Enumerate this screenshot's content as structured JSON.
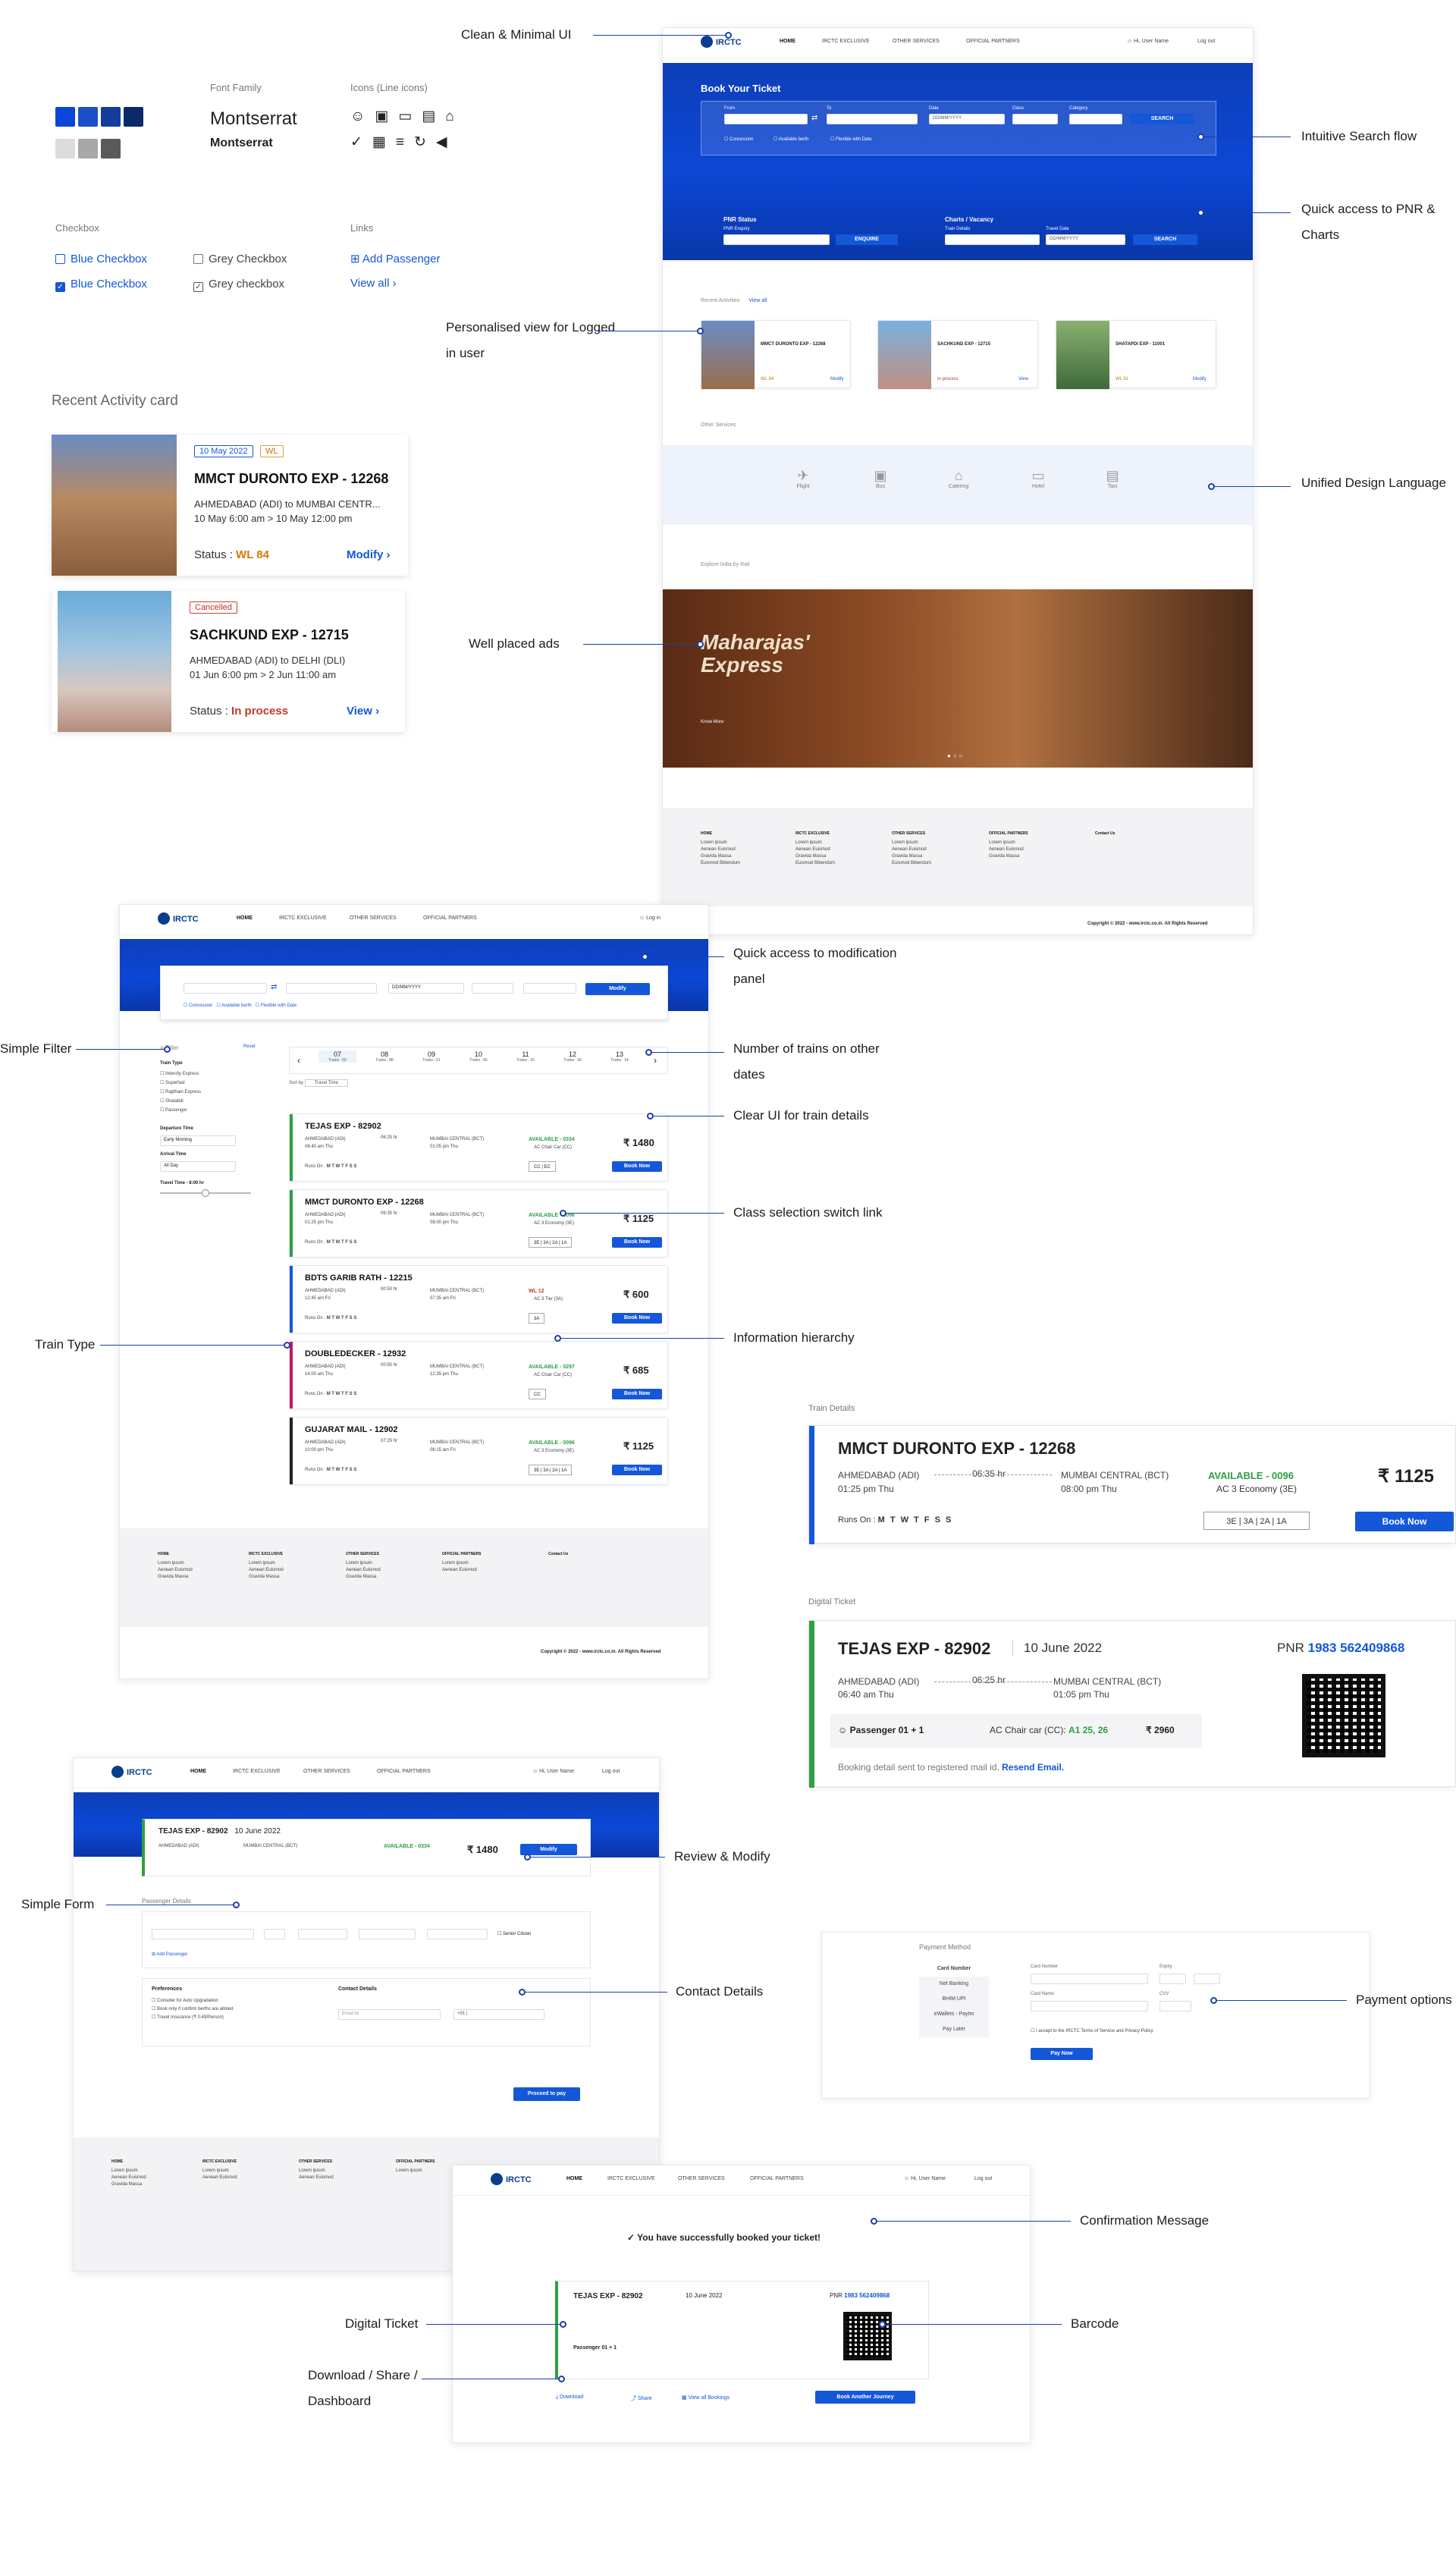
{
  "style_guide": {
    "font_family_label": "Font Family",
    "font_name": "Montserrat",
    "font_name_small": "Montserrat",
    "icons_label": "Icons (Line icons)",
    "colors": [
      "#0a46d8",
      "#1d4fc8",
      "#143c9a",
      "#0b2a6a",
      "#dcdcdc",
      "#a8a8a8",
      "#5a5a5a"
    ],
    "checkbox_label": "Checkbox",
    "blue_checkbox": "Blue Checkbox",
    "grey_checkbox": "Grey Checkbox",
    "blue_checkbox_checked": "Blue Checkbox",
    "grey_checkbox_checked": "Grey checkbox",
    "links_label": "Links",
    "add_passenger": "Add Passenger",
    "view_all": "View all",
    "recent_activity_label": "Recent Activity card"
  },
  "activity_cards": [
    {
      "date": "10 May 2022",
      "tag": "WL",
      "name": "MMCT DURONTO EXP - 12268",
      "route": "AHMEDABAD (ADI) to MUMBAI CENTR...",
      "time": "10 May 6:00 am > 10 May 12:00 pm",
      "status_label": "Status :",
      "status": "WL 84",
      "action": "Modify"
    },
    {
      "tag": "Cancelled",
      "name": "SACHKUND EXP - 12715",
      "route": "AHMEDABAD (ADI) to DELHI (DLI)",
      "time": "01 Jun 6:00 pm > 2 Jun 11:00 am",
      "status_label": "Status :",
      "status": "In process",
      "action": "View"
    }
  ],
  "annotations": {
    "clean_ui": "Clean & Minimal UI",
    "search_flow": "Intuitive Search flow",
    "pnr_charts": "Quick access to PNR & Charts",
    "personalised": "Personalised view for Logged in user",
    "unified": "Unified Design Language",
    "ads": "Well placed ads",
    "modify_panel": "Quick access to modification panel",
    "simple_filter": "Simple Filter",
    "num_trains": "Number of trains on other dates",
    "clear_ui": "Clear UI for train details",
    "class_switch": "Class selection switch link",
    "info_hierarchy": "Information hierarchy",
    "train_type": "Train Type",
    "review_modify": "Review & Modify",
    "simple_form": "Simple Form",
    "contact_details": "Contact Details",
    "payment_options": "Payment options",
    "confirmation": "Confirmation Message",
    "digital_ticket": "Digital Ticket",
    "barcode": "Barcode",
    "download_share": "Download / Share / Dashboard"
  },
  "home": {
    "logo": "IRCTC",
    "nav": [
      "HOME",
      "IRCTC EXCLUSIVE",
      "OTHER SERVICES",
      "OFFICIAL PARTNERS"
    ],
    "user": "Hi, User Name",
    "logout": "Log out",
    "book_title": "Book Your Ticket",
    "from": "From",
    "to": "To",
    "date": "Date",
    "class": "Class",
    "category": "Category",
    "date_val": "DD/MM/YYYY",
    "search": "SEARCH",
    "concession": "Concession",
    "berth": "Available berth",
    "flexible": "Flexible with Date",
    "pnr_title": "PNR Status",
    "pnr_enquiry": "PNR Enquiry",
    "enquire": "ENQUIRE",
    "charts_title": "Charts / Vacancy",
    "train_details": "Train Details",
    "travel_date": "Travel Date",
    "recent": "Recent Activities",
    "view_all": "View all",
    "other_services": "Other Services",
    "services": [
      "Flight",
      "Bus",
      "Catering",
      "Hotel",
      "Taxi"
    ],
    "explore": "Explore India by Rail",
    "ad_title": "Maharajas' Express",
    "ad_cta": "Know More",
    "recent_cards": [
      {
        "name": "MMCT DURONTO EXP - 12268",
        "status": "WL 84",
        "action": "Modify"
      },
      {
        "name": "SACHKUND EXP - 12715",
        "status": "In process",
        "action": "View"
      },
      {
        "name": "SHATAPDI EXP - 11001",
        "status": "WL 81",
        "action": "Modify"
      }
    ],
    "footer_heads": [
      "HOME",
      "IRCTC EXCLUSIVE",
      "OTHER SERVICES",
      "OFFICIAL PARTNERS",
      "Contact Us"
    ],
    "copyright": "Copyright © 2022 - www.irctc.co.in. All Rights Reserved"
  },
  "results": {
    "login": "Log in",
    "modify": "Modify",
    "filter": "Filter",
    "reset": "Reset",
    "train_type": "Train Type",
    "types": [
      "Intercity Express",
      "Superfast",
      "Rajdhani Express",
      "Shatabdi",
      "Passenger"
    ],
    "departure": "Departure Time",
    "early": "Early Morning",
    "arrival": "Arrival Time",
    "all_day": "All Day",
    "travel_time": "Travel Time - 8:00 hr",
    "dates": [
      {
        "d": "07",
        "t": "Trains : 50"
      },
      {
        "d": "08",
        "t": "Trains : 88"
      },
      {
        "d": "09",
        "t": "Trains : 61"
      },
      {
        "d": "10",
        "t": "Trains : 55"
      },
      {
        "d": "11",
        "t": "Trains : 15"
      },
      {
        "d": "12",
        "t": "Trains : 18"
      },
      {
        "d": "13",
        "t": "Trains : 14"
      }
    ],
    "sort": "Sort by",
    "sort_val": "Travel Time",
    "trains": [
      {
        "name": "TEJAS EXP - 82902",
        "color": "#2ea043",
        "from": "AHMEDABAD (ADI)",
        "dep": "06:40 am Thu",
        "dur": "06:25 hr",
        "to": "MUMBAI CENTRAL (BCT)",
        "arr": "01:05 pm Thu",
        "avail": "AVAILABLE - 0334",
        "avcol": "#2ea043",
        "cls": "AC Chair Car (CC)",
        "fare": "₹ 1480",
        "sel": "CC | EC"
      },
      {
        "name": "MMCT DURONTO EXP - 12268",
        "color": "#2ea043",
        "from": "AHMEDABAD (ADI)",
        "dep": "01:25 pm Thu",
        "dur": "06:35 hr",
        "to": "MUMBAI CENTRAL (BCT)",
        "arr": "08:00 pm Thu",
        "avail": "AVAILABLE - 0096",
        "avcol": "#2ea043",
        "cls": "AC 3 Economy (3E)",
        "fare": "₹ 1125",
        "sel": "3E | 3A | 2A | 1A"
      },
      {
        "name": "BDTS GARIB RATH - 12215",
        "color": "#1457d9",
        "from": "AHMEDABAD (ADI)",
        "dep": "12:45 am Fri",
        "dur": "00:50 hr",
        "to": "MUMBAI CENTRAL (BCT)",
        "arr": "07:35 am Fri",
        "avail": "WL 12",
        "avcol": "#c0392b",
        "cls": "AC 3 Tier (3A)",
        "fare": "₹ 600",
        "sel": "3A"
      },
      {
        "name": "DOUBLEDECKER - 12932",
        "color": "#c2185b",
        "from": "AHMEDABAD (ADI)",
        "dep": "14:00 am Thu",
        "dur": "00:50 hr",
        "to": "MUMBAI CENTRAL (BCT)",
        "arr": "12:35 pm Thu",
        "avail": "AVAILABLE - 0297",
        "avcol": "#2ea043",
        "cls": "AC Chair Car (CC)",
        "fare": "₹ 685",
        "sel": "CC"
      },
      {
        "name": "GUJARAT MAIL - 12902",
        "color": "#222",
        "from": "AHMEDABAD (ADI)",
        "dep": "10:00 pm Thu",
        "dur": "07:25 hr",
        "to": "MUMBAI CENTRAL (BCT)",
        "arr": "06:15 am Fri",
        "avail": "AVAILABLE - 0096",
        "avcol": "#2ea043",
        "cls": "AC 3 Economy (3E)",
        "fare": "₹ 1125",
        "sel": "3E | 3A | 2A | 1A"
      }
    ],
    "runs_on": "Runs On :",
    "days": "M T W T F S S",
    "book_now": "Book Now"
  },
  "train_details": {
    "label": "Train Details",
    "name": "MMCT DURONTO EXP - 12268",
    "from": "AHMEDABAD (ADI)",
    "dep": "01:25 pm Thu",
    "dur": "06:35 hr",
    "to": "MUMBAI CENTRAL (BCT)",
    "arr": "08:00 pm Thu",
    "avail": "AVAILABLE - 0096",
    "cls": "AC 3 Economy (3E)",
    "fare": "₹ 1125",
    "runs_on": "Runs On :",
    "days": "M T W T F S S",
    "sel": "3E | 3A | 2A | 1A",
    "book": "Book Now"
  },
  "digital_ticket": {
    "label": "Digital Ticket",
    "name": "TEJAS EXP - 82902",
    "date": "10 June 2022",
    "pnr_label": "PNR",
    "pnr": "1983 562409868",
    "from": "AHMEDABAD (ADI)",
    "dep": "06:40 am Thu",
    "dur": "06:25 hr",
    "to": "MUMBAI CENTRAL (BCT)",
    "arr": "01:05 pm Thu",
    "passenger": "Passenger 01 + 1",
    "cls": "AC Chair car (CC):",
    "seats": "A1  25, 26",
    "fare": "₹ 2960",
    "note": "Booking detail sent to registered mail id.",
    "resend": "Resend Email."
  },
  "booking": {
    "name": "TEJAS EXP - 82902",
    "date": "10 June 2022",
    "avail": "AVAILABLE - 0334",
    "fare": "₹ 1480",
    "modify": "Modify",
    "pass_title": "Passenger Details",
    "fields": [
      "Passenger 1 Name",
      "Age",
      "Gender",
      "Berth Preference",
      "Meal Preference"
    ],
    "senior": "Senior Citizen",
    "add_pass": "Add Passenger",
    "pref_title": "Preferences",
    "prefs": [
      "Consider for Auto Upgradation",
      "Book only if confirm berths are alloted",
      "Travel Insurance (₹ 0.49/Person)"
    ],
    "contact_title": "Contact Details",
    "email": "Email",
    "mobile": "Mobile",
    "email_ph": "Email Id",
    "mobile_ph": "+91 |",
    "proceed": "Proceed to pay"
  },
  "payment": {
    "title": "Payment Method",
    "card_number": "Card Number",
    "methods": [
      "Net Banking",
      "BHIM UPI",
      "eWallets - Paytm",
      "Pay Later"
    ],
    "card_no": "Card Number",
    "expiry": "Expiry",
    "card_name": "Card Name",
    "cvv": "CVV",
    "agree": "I accept to the IRCTC Terms of Service and Privacy Policy",
    "pay": "Pay Now"
  },
  "confirm": {
    "message": "You have successfully booked your ticket!",
    "download": "Download",
    "share": "Share",
    "view_all": "View all Bookings",
    "book_another": "Book Another Journey"
  }
}
